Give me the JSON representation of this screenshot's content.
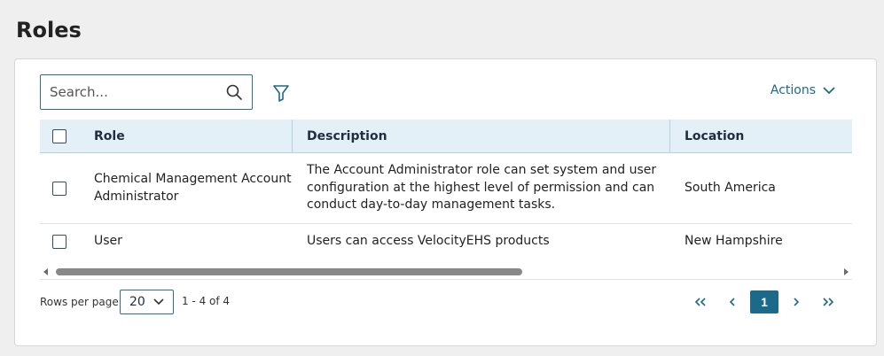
{
  "page": {
    "title": "Roles"
  },
  "toolbar": {
    "search_placeholder": "Search...",
    "actions_label": "Actions"
  },
  "table": {
    "columns": {
      "role": "Role",
      "description": "Description",
      "location": "Location"
    },
    "rows": [
      {
        "role": "Chemical Management Account Administrator",
        "description": "The Account Administrator role can set system and user configuration at the highest level of permission and can conduct day-to-day management tasks.",
        "location": "South America"
      },
      {
        "role": "User",
        "description": "Users can access VelocityEHS products",
        "location": "New Hampshire"
      }
    ]
  },
  "pagination": {
    "rows_per_page_label": "Rows per page",
    "rows_per_page_value": "20",
    "range_text": "1 - 4 of 4",
    "current_page": "1"
  },
  "colors": {
    "accent": "#1c6a8a",
    "header_bg": "#e3f0f8",
    "page_bg": "#efefef"
  }
}
